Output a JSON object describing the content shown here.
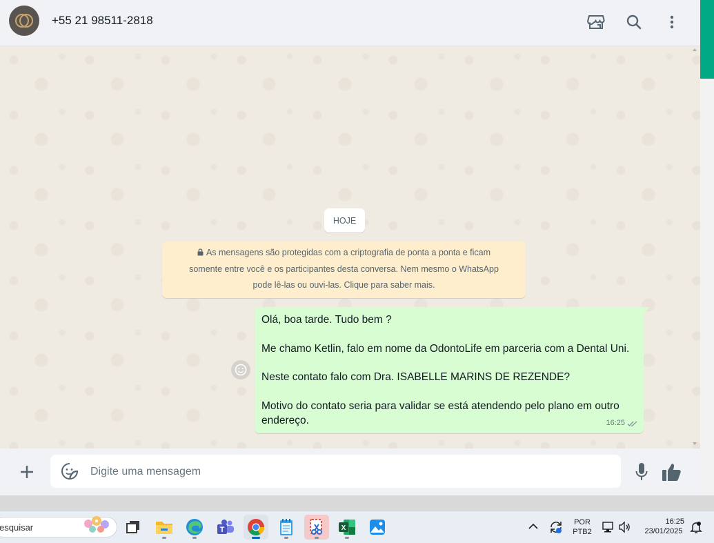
{
  "header": {
    "contact_name": "+55 21 98511-2818",
    "icons": [
      "catalog-store-icon",
      "search-icon",
      "menu-kebab-icon"
    ]
  },
  "chat": {
    "date_label": "HOJE",
    "encryption_notice_line1": "As mensagens são protegidas com a criptografia de ponta a ponta e ficam",
    "encryption_notice_line2": "somente entre você e os participantes desta conversa. Nem mesmo o WhatsApp",
    "encryption_notice_line3": "pode lê-las ou ouvi-las. Clique para saber mais.",
    "message": {
      "line1": "Olá, boa tarde. Tudo bem ?",
      "line2": "Me chamo Ketlin, falo em nome da OdontoLife em parceria com a Dental Uni.",
      "line3": "Neste contato falo com Dra. ISABELLE MARINS DE REZENDE?",
      "line4": "Motivo do contato seria para validar se está atendendo pelo plano em outro endereço.",
      "time": "16:25",
      "status": "delivered-double-check"
    }
  },
  "composer": {
    "placeholder": "Digite uma mensagem"
  },
  "taskbar": {
    "search_text": "esquisar",
    "language_line1": "POR",
    "language_line2": "PTB2",
    "clock_time": "16:25",
    "clock_date": "23/01/2025"
  },
  "colors": {
    "outgoing_bubble": "#d9fdd3",
    "notice_bg": "#ffeecd",
    "accent": "#00a884",
    "chat_bg": "#efeae2"
  }
}
